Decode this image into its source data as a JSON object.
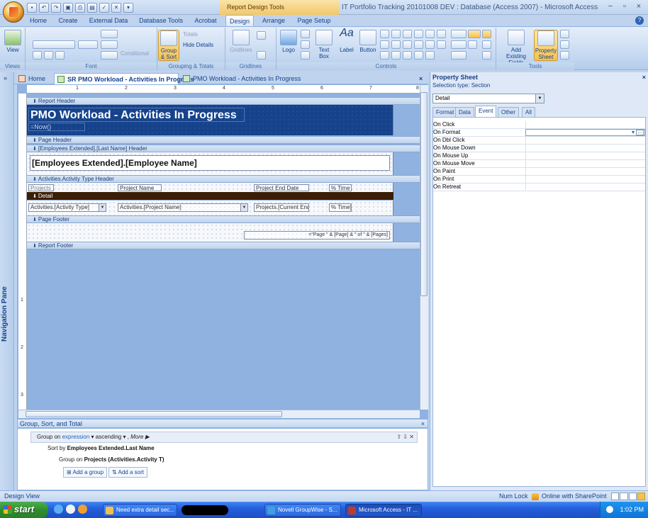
{
  "window": {
    "title": "IT Portfolio Tracking 20101008 DEV : Database (Access 2007) - Microsoft Access",
    "context_tab": "Report Design Tools",
    "controls": [
      "−",
      "▫",
      "×"
    ]
  },
  "ribbon_tabs": [
    "Home",
    "Create",
    "External Data",
    "Database Tools",
    "Acrobat",
    "Design",
    "Arrange",
    "Page Setup"
  ],
  "ribbon": {
    "groups": {
      "views": "Views",
      "font": "Font",
      "grouping": "Grouping & Totals",
      "gridlines": "Gridlines",
      "controls": "Controls",
      "tools": "Tools"
    },
    "view_btn": "View",
    "conditional": "Conditional",
    "group_sort": "Group & Sort",
    "totals": "Totals",
    "hide_details": "Hide Details",
    "gridlines_btn": "Gridlines",
    "logo": "Logo",
    "text_box": "Text Box",
    "label": "Label",
    "button": "Button",
    "add_fields": "Add Existing Fields",
    "property_sheet": "Property Sheet"
  },
  "doc_tabs": {
    "nav_chev": "»",
    "tabs": [
      "Home",
      "SR PMO Workload - Activities In Progress",
      "PMO Workload - Activities In Progress"
    ],
    "close": "×"
  },
  "nav_pane": "Navigation Pane",
  "ruler": [
    "1",
    "2",
    "3",
    "4",
    "5",
    "6",
    "7",
    "8"
  ],
  "ruler_v": [
    "1",
    "2",
    "3"
  ],
  "report": {
    "sections": {
      "report_header": "Report Header",
      "page_header": "Page Header",
      "employee_header": "[Employees Extended].[Last Name] Header",
      "activity_header": "Activities.Activity Type Header",
      "detail": "Detail",
      "page_footer": "Page Footer",
      "report_footer": "Report Footer"
    },
    "title": "PMO Workload - Activities In Progress",
    "now": "=Now()",
    "employee_name": "[Employees Extended].[Employee Name]",
    "col_projects": "Projects",
    "col_project_name": "Project Name",
    "col_end_date": "Project End Date",
    "col_pct_time": "% Time",
    "det_activity_type": "Activities.[Activity Type]",
    "det_project_name": "Activities.[Project Name]",
    "det_end_date": "Projects.[Current End",
    "det_pct_time": "% Time]",
    "page_expr": "=\"Page \" & [Page] & \" of \" & [Pages]"
  },
  "group_sort": {
    "title": "Group, Sort, and Total",
    "close": "×",
    "row1": {
      "prefix": "Group on",
      "field": "expression",
      "order": "ascending",
      "more": "More ▶"
    },
    "row2": {
      "prefix": "Sort by",
      "field": "Employees Extended.Last Name"
    },
    "row3": {
      "prefix": "Group on",
      "field": "Projects (Activities.Activity T)"
    },
    "add_group": "Add a group",
    "add_sort": "Add a sort"
  },
  "property_sheet": {
    "title": "Property Sheet",
    "close": "×",
    "selection_type": "Selection type:  Section",
    "selected": "Detail",
    "tabs": [
      "Format",
      "Data",
      "Event",
      "Other",
      "All"
    ],
    "active_tab": "Event",
    "properties": [
      "On Click",
      "On Format",
      "On Dbl Click",
      "On Mouse Down",
      "On Mouse Up",
      "On Mouse Move",
      "On Paint",
      "On Print",
      "On Retreat"
    ]
  },
  "status": {
    "left": "Design View",
    "num_lock": "Num Lock",
    "sharepoint": "Online with SharePoint"
  },
  "taskbar": {
    "start": "start",
    "tasks": [
      "Need extra detail sec...",
      "Novell GroupWise - S...",
      "Microsoft Access - IT ..."
    ],
    "clock": "1:02 PM"
  }
}
